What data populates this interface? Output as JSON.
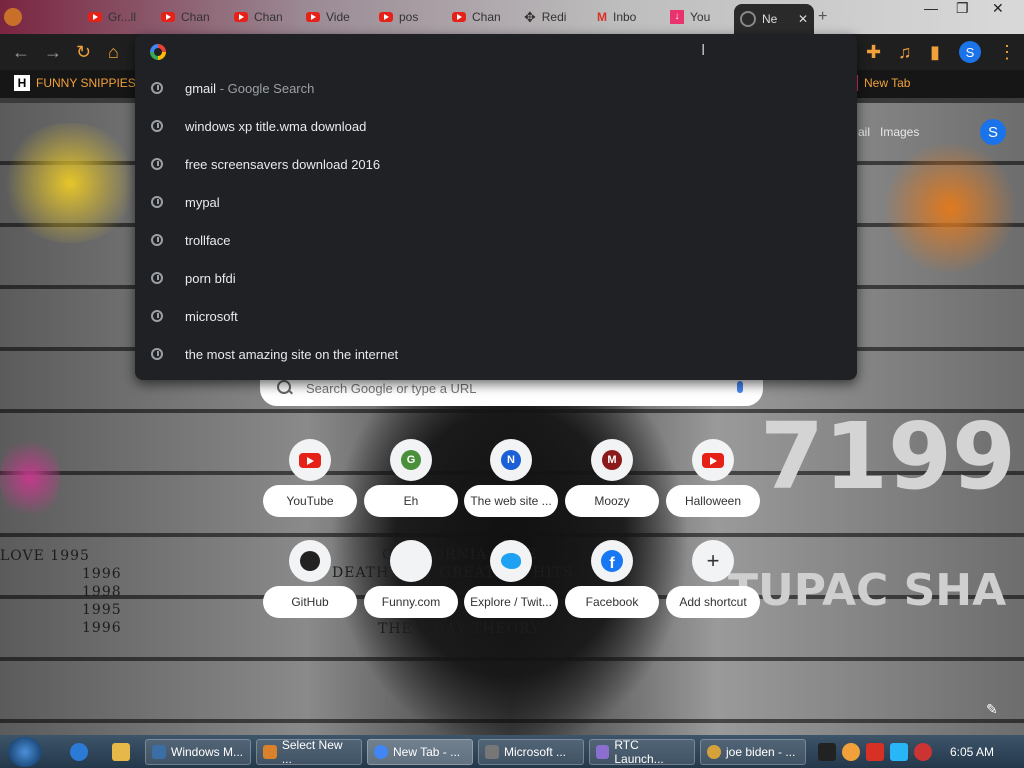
{
  "browser": {
    "tabs": [
      {
        "label": "Gr...ll",
        "icon": "youtube-icon"
      },
      {
        "label": "Chan",
        "icon": "youtube-icon"
      },
      {
        "label": "Chan",
        "icon": "youtube-icon"
      },
      {
        "label": "Vide",
        "icon": "youtube-icon"
      },
      {
        "label": "pos",
        "icon": "youtube-icon"
      },
      {
        "label": "Chan",
        "icon": "youtube-icon"
      },
      {
        "label": "Redi",
        "icon": "move-icon"
      },
      {
        "label": "Inbo",
        "icon": "gmail-icon"
      },
      {
        "label": "You",
        "icon": "download-icon"
      },
      {
        "label": "Ne",
        "icon": "chrome-icon"
      }
    ],
    "window_controls": {
      "minimize": "—",
      "maximize": "❐",
      "close": "✕"
    },
    "new_tab_symbol": "+",
    "profile_letter": "S"
  },
  "bookmarks": [
    {
      "label": "FUNNY SNIPPIES",
      "icon": "h-icon"
    },
    {
      "label": "New Tab",
      "icon": "page-icon"
    }
  ],
  "omnibox": {
    "value": "",
    "suggestions": [
      {
        "text": "gmail",
        "sub": " - Google Search"
      },
      {
        "text": "windows xp title.wma download",
        "sub": ""
      },
      {
        "text": "free screensavers download 2016",
        "sub": ""
      },
      {
        "text": "mypal",
        "sub": ""
      },
      {
        "text": "trollface",
        "sub": ""
      },
      {
        "text": "porn bfdi",
        "sub": ""
      },
      {
        "text": "microsoft",
        "sub": ""
      },
      {
        "text": "the most amazing site on the internet",
        "sub": ""
      }
    ]
  },
  "ntp": {
    "top_links": {
      "gmail": "ail",
      "images": "Images"
    },
    "profile_letter": "S",
    "search_placeholder": "Search Google or type a URL",
    "shortcuts": [
      {
        "label": "YouTube",
        "icon": "youtube-icon"
      },
      {
        "label": "Eh",
        "icon": "letter-g-icon",
        "letter": "G"
      },
      {
        "label": "The web site ...",
        "icon": "letter-n-icon",
        "letter": "N"
      },
      {
        "label": "Moozy",
        "icon": "letter-m-icon",
        "letter": "M"
      },
      {
        "label": "Halloween",
        "icon": "youtube-icon"
      },
      {
        "label": "GitHub",
        "icon": "github-icon"
      },
      {
        "label": "Funny.com",
        "icon": "blank-icon"
      },
      {
        "label": "Explore / Twit...",
        "icon": "twitter-icon"
      },
      {
        "label": "Facebook",
        "icon": "facebook-icon"
      },
      {
        "label": "Add shortcut",
        "icon": "plus-icon"
      }
    ]
  },
  "wallpaper_text": {
    "years_left": [
      "LOVE   1995",
      "1996",
      "1998",
      "1995",
      "1996"
    ],
    "center": [
      "CALIFORNIA LOVE",
      "DEATH ROW GREATEST HITS",
      "THE 7 DAY THEORY"
    ],
    "big_number": "7199",
    "big_name": "TUPAC SHA"
  },
  "taskbar": {
    "buttons": [
      {
        "label": "Windows M...",
        "color": "#3a6ea5"
      },
      {
        "label": "Select New ...",
        "color": "#d9822b"
      },
      {
        "label": "New Tab - ...",
        "color": "#4285f4"
      },
      {
        "label": "Microsoft ...",
        "color": "#777777"
      },
      {
        "label": "RTC Launch...",
        "color": "#8a6fd1"
      },
      {
        "label": "joe biden - ...",
        "color": "#d4a23a"
      }
    ],
    "time": "6:05 AM"
  }
}
